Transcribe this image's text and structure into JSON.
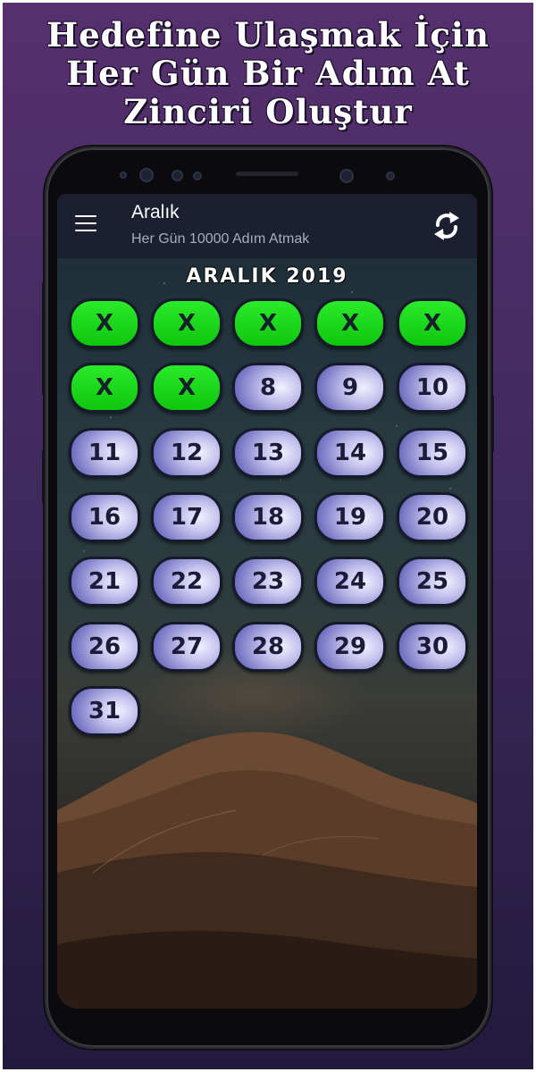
{
  "headline": {
    "line1": "Hedefine Ulaşmak İçin",
    "line2": "Her Gün Bir Adım At",
    "line3": "Zinciri Oluştur"
  },
  "appbar": {
    "title": "Aralık",
    "subtitle": "Her Gün 10000 Adım Atmak"
  },
  "calendar": {
    "month_title": "ARALIK 2019",
    "done_mark": "X",
    "done_color": "#10D010",
    "pending_color": "#C6C3EE",
    "days": [
      {
        "label": "X",
        "done": true
      },
      {
        "label": "X",
        "done": true
      },
      {
        "label": "X",
        "done": true
      },
      {
        "label": "X",
        "done": true
      },
      {
        "label": "X",
        "done": true
      },
      {
        "label": "X",
        "done": true
      },
      {
        "label": "X",
        "done": true
      },
      {
        "label": "8",
        "done": false
      },
      {
        "label": "9",
        "done": false
      },
      {
        "label": "10",
        "done": false
      },
      {
        "label": "11",
        "done": false
      },
      {
        "label": "12",
        "done": false
      },
      {
        "label": "13",
        "done": false
      },
      {
        "label": "14",
        "done": false
      },
      {
        "label": "15",
        "done": false
      },
      {
        "label": "16",
        "done": false
      },
      {
        "label": "17",
        "done": false
      },
      {
        "label": "18",
        "done": false
      },
      {
        "label": "19",
        "done": false
      },
      {
        "label": "20",
        "done": false
      },
      {
        "label": "21",
        "done": false
      },
      {
        "label": "22",
        "done": false
      },
      {
        "label": "23",
        "done": false
      },
      {
        "label": "24",
        "done": false
      },
      {
        "label": "25",
        "done": false
      },
      {
        "label": "26",
        "done": false
      },
      {
        "label": "27",
        "done": false
      },
      {
        "label": "28",
        "done": false
      },
      {
        "label": "29",
        "done": false
      },
      {
        "label": "30",
        "done": false
      },
      {
        "label": "31",
        "done": false
      }
    ]
  },
  "icons": {
    "menu": "hamburger-menu-icon",
    "refresh": "refresh-icon"
  }
}
